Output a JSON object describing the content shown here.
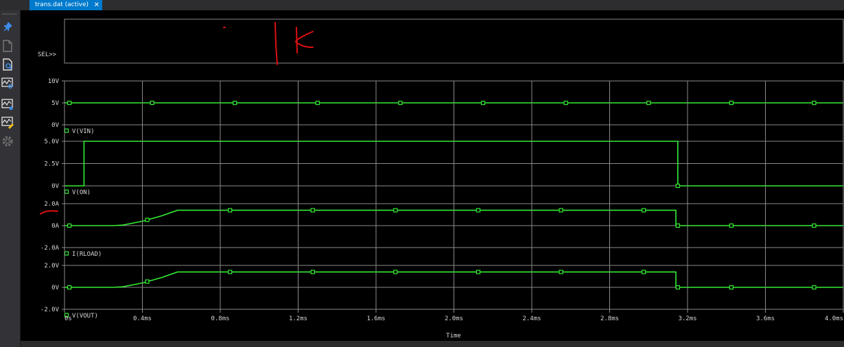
{
  "tab": {
    "title": "trans.dat (active)",
    "close_glyph": "✕"
  },
  "toolbar": {
    "items": [
      {
        "name": "pin-icon"
      },
      {
        "name": "document-icon"
      },
      {
        "name": "zoom-document-icon"
      },
      {
        "name": "zoom-waveform-icon"
      },
      {
        "name": "waveform-settings-icon"
      },
      {
        "name": "waveform-edit-icon"
      },
      {
        "name": "gear-icon"
      }
    ]
  },
  "colors": {
    "trace": "#34ee34",
    "grid": "#8c8c8c",
    "text": "#d8d8d8",
    "background": "#000000",
    "markup": "#e01010"
  },
  "sel_label": "SEL>>",
  "chart_data": {
    "type": "line",
    "x_axis": {
      "label": "Time",
      "range_ms": [
        0,
        4.0
      ],
      "ticks_ms": [
        0,
        0.4,
        0.8,
        1.2,
        1.6,
        2.0,
        2.4,
        2.8,
        3.2,
        3.6,
        4.0
      ],
      "tick_labels": [
        "0s",
        "0.4ms",
        "0.8ms",
        "1.2ms",
        "1.6ms",
        "2.0ms",
        "2.4ms",
        "2.8ms",
        "3.2ms",
        "3.6ms",
        "4.0ms"
      ]
    },
    "grid": true,
    "panels": [
      {
        "series_name": "V(VIN)",
        "ylim": [
          0,
          10
        ],
        "ticks": [
          10,
          5,
          0
        ],
        "tick_labels": [
          "10V",
          "5V",
          "0V"
        ],
        "points": [
          [
            0,
            5
          ],
          [
            4.0,
            5
          ]
        ],
        "marker_x_ms": [
          0.025,
          0.45,
          0.875,
          1.3,
          1.725,
          2.15,
          2.575,
          3.0,
          3.425,
          3.85
        ]
      },
      {
        "series_name": "V(ON)",
        "ylim": [
          0,
          5
        ],
        "ticks": [
          5,
          2.5,
          0
        ],
        "tick_labels": [
          "5.0V",
          "2.5V",
          "0V"
        ],
        "points": [
          [
            0,
            0
          ],
          [
            0.1,
            0
          ],
          [
            0.1,
            5
          ],
          [
            3.15,
            5
          ],
          [
            3.15,
            0
          ],
          [
            4.0,
            0
          ]
        ],
        "marker_x_ms": [
          3.15
        ]
      },
      {
        "series_name": "I(RLOAD)",
        "ylim": [
          -2,
          2
        ],
        "ticks": [
          2,
          0,
          -2
        ],
        "tick_labels": [
          "2.0A",
          "0A",
          "-2.0A"
        ],
        "points": [
          [
            0,
            0
          ],
          [
            0.2,
            0
          ],
          [
            0.25,
            0
          ],
          [
            0.3,
            0.05
          ],
          [
            0.4,
            0.4
          ],
          [
            0.5,
            0.9
          ],
          [
            0.58,
            1.4
          ],
          [
            3.14,
            1.4
          ],
          [
            3.14,
            0
          ],
          [
            4.0,
            0
          ]
        ],
        "marker_x_ms": [
          0.025,
          0.425,
          0.85,
          1.275,
          1.7,
          2.125,
          2.55,
          2.975,
          3.15,
          3.425,
          3.85
        ]
      },
      {
        "series_name": "V(VOUT)",
        "ylim": [
          -2,
          2
        ],
        "ticks": [
          2,
          0,
          -2
        ],
        "tick_labels": [
          "2.0V",
          "0V",
          "-2.0V"
        ],
        "points": [
          [
            0,
            0
          ],
          [
            0.2,
            0
          ],
          [
            0.25,
            0
          ],
          [
            0.3,
            0.05
          ],
          [
            0.4,
            0.4
          ],
          [
            0.5,
            0.9
          ],
          [
            0.58,
            1.4
          ],
          [
            3.14,
            1.4
          ],
          [
            3.14,
            0
          ],
          [
            4.0,
            0
          ]
        ],
        "marker_x_ms": [
          0.025,
          0.425,
          0.85,
          1.275,
          1.7,
          2.125,
          2.55,
          2.975,
          3.15,
          3.425,
          3.85
        ]
      }
    ]
  }
}
